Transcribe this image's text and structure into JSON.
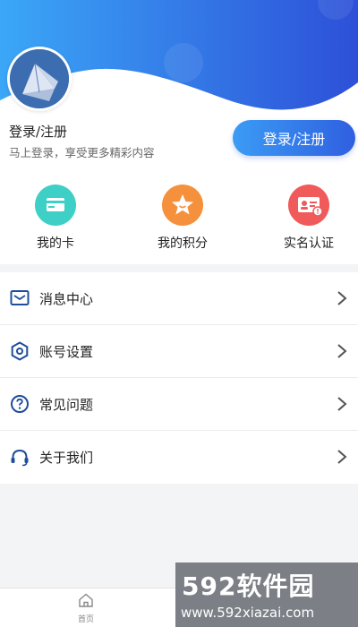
{
  "account": {
    "title": "登录/注册",
    "subtitle": "马上登录，享受更多精彩内容",
    "login_button": "登录/注册"
  },
  "quick_actions": [
    {
      "label": "我的卡",
      "icon": "card-icon",
      "color": "#3ecfc7"
    },
    {
      "label": "我的积分",
      "icon": "star-icon",
      "color": "#f5913c"
    },
    {
      "label": "实名认证",
      "icon": "id-card-icon",
      "color": "#f05a5a"
    }
  ],
  "menu": [
    {
      "label": "消息中心",
      "icon": "message-icon"
    },
    {
      "label": "账号设置",
      "icon": "settings-icon"
    },
    {
      "label": "常见问题",
      "icon": "question-icon"
    },
    {
      "label": "关于我们",
      "icon": "headset-icon"
    }
  ],
  "tabbar": {
    "home_label": "首页"
  },
  "watermark": {
    "brand": "592软件园",
    "url": "www.592xiazai.com"
  },
  "colors": {
    "accent": "#2f5fe0",
    "gradient_start": "#3ba7f7",
    "gradient_end": "#2d50d8"
  }
}
